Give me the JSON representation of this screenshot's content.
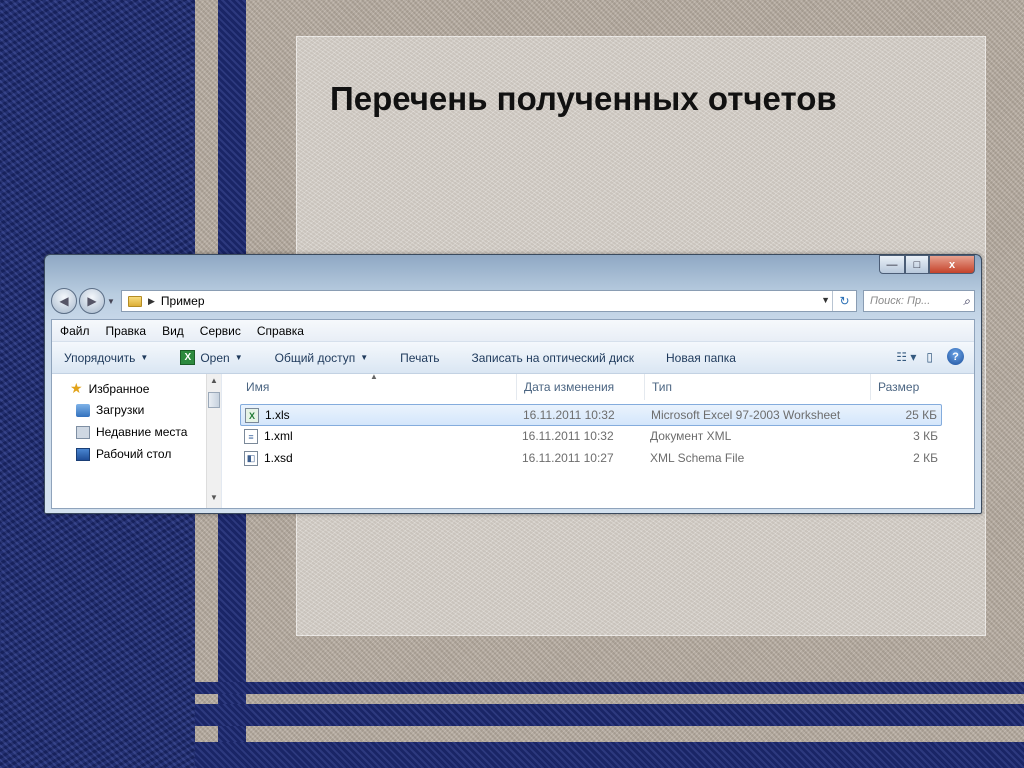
{
  "slide": {
    "title": "Перечень полученных отчетов"
  },
  "window": {
    "controls": {
      "minimize": "—",
      "maximize": "□",
      "close": "x"
    },
    "address": {
      "path": "Пример"
    },
    "search": {
      "placeholder": "Поиск: Пр..."
    },
    "menu": [
      "Файл",
      "Правка",
      "Вид",
      "Сервис",
      "Справка"
    ],
    "toolbar": {
      "organize": "Упорядочить",
      "open": "Open",
      "share": "Общий доступ",
      "print": "Печать",
      "burn": "Записать на оптический диск",
      "new_folder": "Новая папка"
    },
    "nav": {
      "favorites": "Избранное",
      "items": [
        "Загрузки",
        "Недавние места",
        "Рабочий стол"
      ]
    },
    "columns": {
      "name": "Имя",
      "date": "Дата изменения",
      "type": "Тип",
      "size": "Размер"
    },
    "files": [
      {
        "name": "1.xls",
        "date": "16.11.2011 10:32",
        "type": "Microsoft Excel 97-2003 Worksheet",
        "size": "25 КБ",
        "icon": "excel-file-icon",
        "selected": true
      },
      {
        "name": "1.xml",
        "date": "16.11.2011 10:32",
        "type": "Документ XML",
        "size": "3 КБ",
        "icon": "xml-file-icon",
        "selected": false
      },
      {
        "name": "1.xsd",
        "date": "16.11.2011 10:27",
        "type": "XML Schema File",
        "size": "2 КБ",
        "icon": "xsd-file-icon",
        "selected": false
      }
    ]
  },
  "colors": {
    "navy": "#1d2a74",
    "selection": "#d4e6fb",
    "accent": "#1e395b"
  }
}
